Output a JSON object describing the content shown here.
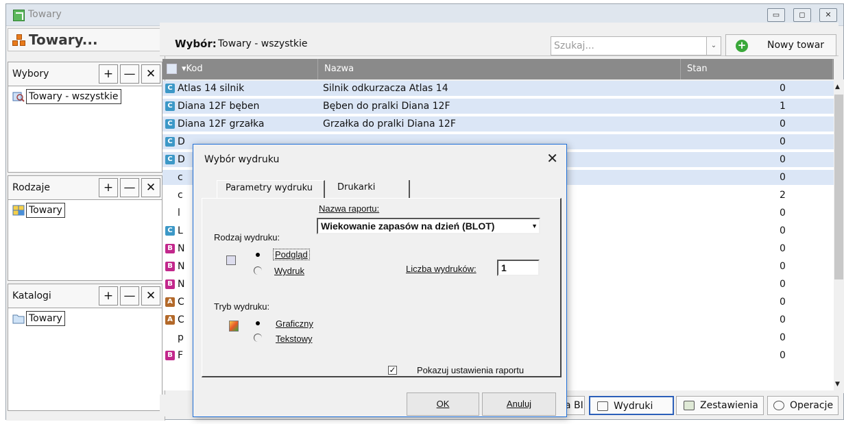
{
  "window": {
    "title": "Towary",
    "buttons": [
      "▭",
      "◻",
      "✕"
    ]
  },
  "left": {
    "header_title": "Towary...",
    "sections": [
      {
        "title": "Wybory",
        "item": "Towary - wszystkie",
        "item_icon": "search-list-icon"
      },
      {
        "title": "Rodzaje",
        "item": "Towary",
        "item_icon": "category-grid-icon"
      },
      {
        "title": "Katalogi",
        "item": "Towary",
        "item_icon": "folder-icon"
      }
    ],
    "btn_add": "+",
    "btn_remove": "—",
    "btn_close": "✕"
  },
  "topbar": {
    "selection_label": "Wybór:",
    "selection_value": "Towary - wszystkie",
    "search_placeholder": "Szukaj...",
    "dropdown_arrow": "⌄",
    "new_button": "Nowy towar"
  },
  "table": {
    "headers": {
      "code": "▾Kod",
      "name": "Nazwa",
      "stock": "Stan"
    },
    "rows": [
      {
        "badge": "C",
        "code": "Atlas 14 silnik",
        "name": "Silnik odkurzacza Atlas 14",
        "stock": "0",
        "selected": true
      },
      {
        "badge": "C",
        "code": "Diana 12F bęben",
        "name": "Bęben do pralki Diana 12F",
        "stock": "1",
        "selected": true
      },
      {
        "badge": "C",
        "code": "Diana 12F grzałka",
        "name": "Grzałka do pralki Diana 12F",
        "stock": "0",
        "selected": true
      },
      {
        "badge": "C",
        "code": "D",
        "name": "",
        "stock": "0",
        "selected": true
      },
      {
        "badge": "C",
        "code": "D",
        "name": "",
        "stock": "0",
        "selected": true
      },
      {
        "badge": "",
        "code": "c",
        "name": "",
        "stock": "0",
        "selected": true
      },
      {
        "badge": "",
        "code": "c",
        "name": "",
        "stock": "2",
        "selected": false
      },
      {
        "badge": "",
        "code": "l",
        "name": "",
        "stock": "0",
        "selected": false
      },
      {
        "badge": "C",
        "code": "L",
        "name": "",
        "stock": "0",
        "selected": false
      },
      {
        "badge": "B",
        "code": "N",
        "name": "",
        "stock": "0",
        "selected": false
      },
      {
        "badge": "B",
        "code": "N",
        "name": "",
        "stock": "0",
        "selected": false
      },
      {
        "badge": "B",
        "code": "N",
        "name": "",
        "stock": "0",
        "selected": false
      },
      {
        "badge": "A",
        "code": "C",
        "name": "",
        "stock": "0",
        "selected": false
      },
      {
        "badge": "A",
        "code": "C",
        "name": "",
        "stock": "0",
        "selected": false
      },
      {
        "badge": "",
        "code": "p",
        "name": "",
        "stock": "0",
        "selected": false
      },
      {
        "badge": "B",
        "code": "F",
        "name": "",
        "stock": "0",
        "selected": false
      }
    ]
  },
  "bottombar": {
    "partial_label": "a BI",
    "prints": "Wydruki",
    "reports": "Zestawienia",
    "operations": "Operacje"
  },
  "dialog": {
    "title": "Wybór wydruku",
    "close": "✕",
    "tab_params": "Parametry wydruku",
    "tab_printers": "Drukarki",
    "report_name_label": "Nazwa raportu:",
    "report_name_value": "Wiekowanie zapasów na dzień (BLOT)",
    "print_kind_label": "Rodzaj wydruku:",
    "opt_preview": "Podgląd",
    "opt_print": "Wydruk",
    "copies_label": "Liczba wydruków:",
    "copies_value": "1",
    "mode_label": "Tryb wydruku:",
    "opt_graphic": "Graficzny",
    "opt_text": "Tekstowy",
    "show_settings": "Pokazuj ustawienia raportu",
    "ok": "OK",
    "cancel": "Anuluj"
  },
  "colors": {
    "badge_C": "#3c98c7",
    "badge_B": "#c2288c",
    "badge_A": "#b3692a",
    "selection": "#dbe6f6",
    "dialog_border": "#1e6fd9"
  }
}
